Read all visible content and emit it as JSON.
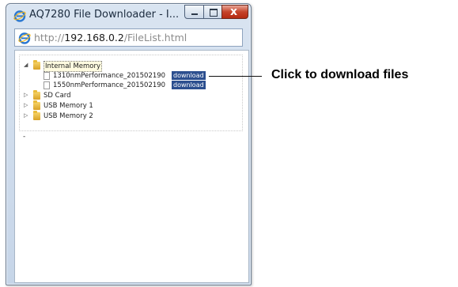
{
  "window": {
    "title": "AQ7280 File Downloader - I...",
    "controls": {
      "minimize_icon": "minimize-icon",
      "maximize_icon": "maximize-icon",
      "close_glyph": "x"
    }
  },
  "address_bar": {
    "url_scheme": "http://",
    "url_host": "192.168.0.2",
    "url_path": "/FileList.html"
  },
  "tree": {
    "nodes": [
      {
        "label": "Internal Memory",
        "expanded": true,
        "selected": true,
        "children": [
          {
            "file": "1310nmPerformance_201502190",
            "action": "download"
          },
          {
            "file": "1550nmPerformance_201502190",
            "action": "download"
          }
        ]
      },
      {
        "label": "SD Card",
        "expanded": false
      },
      {
        "label": "USB Memory 1",
        "expanded": false
      },
      {
        "label": "USB Memory 2",
        "expanded": false
      }
    ]
  },
  "footer_mark": "-",
  "callout": {
    "text": "Click to download files"
  },
  "colors": {
    "download_bg": "#2c4f8f",
    "close_button": "#c5432a",
    "folder": "#e9bc3c"
  }
}
